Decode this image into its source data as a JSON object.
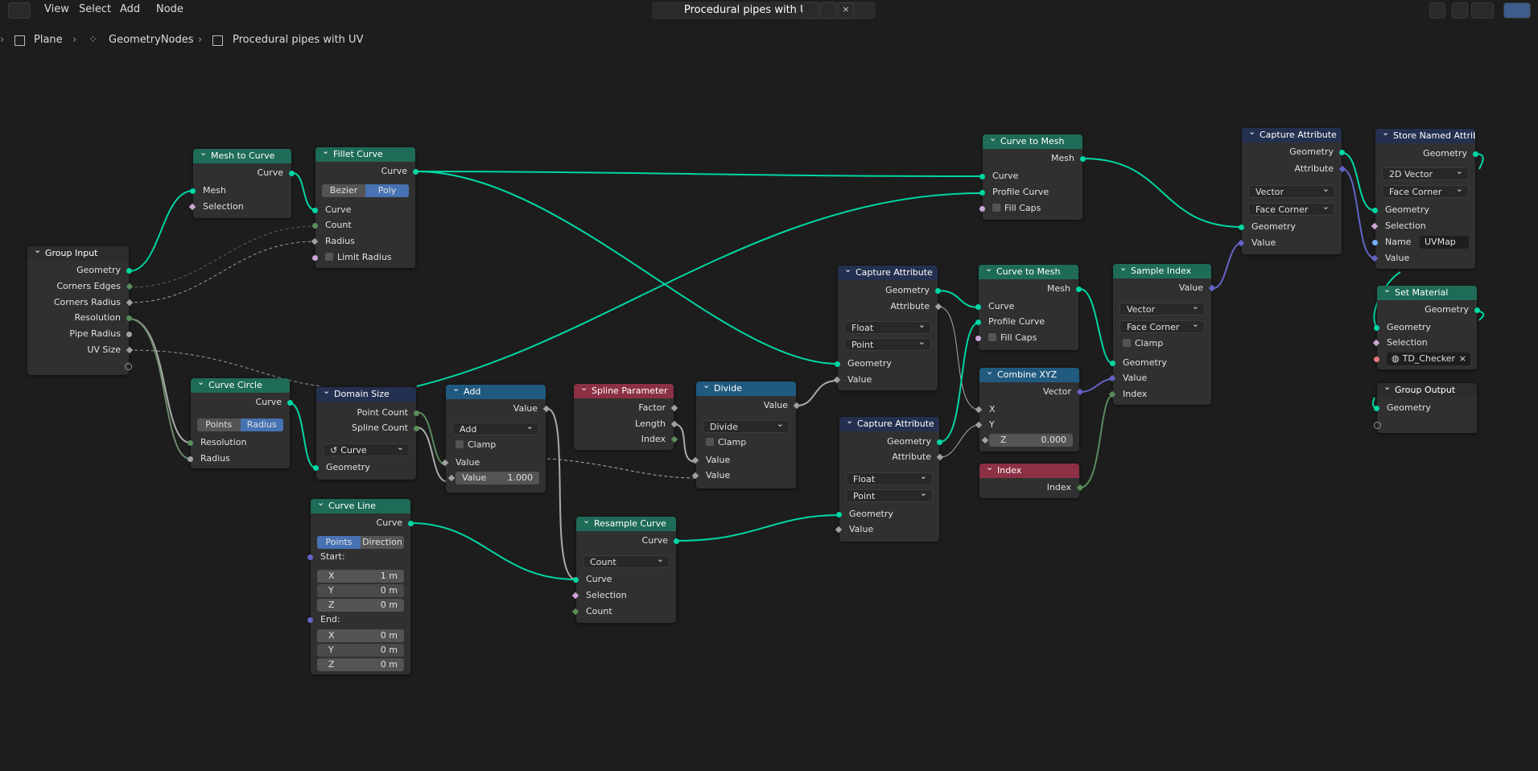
{
  "menubar": {
    "view": "View",
    "select": "Select",
    "add": "Add",
    "node": "Node"
  },
  "header": {
    "tree_name": "Procedural pipes with UV"
  },
  "breadcrumb": {
    "object": "Plane",
    "modifier": "GeometryNodes",
    "tree": "Procedural pipes with UV"
  },
  "colors": {
    "geometry_socket": "#00d6a3",
    "float_socket": "#a1a1a1",
    "vector_socket": "#6363c7",
    "boolean_socket": "#cca6d6",
    "integer_socket": "#598c5c",
    "string_socket": "#70b2ff",
    "material_socket": "#eb7582",
    "geometry_header": "#1e6b58",
    "attribute_header": "#24304f",
    "converter_header": "#215a7f",
    "input_header": "#8b3045",
    "selected_option": "#4772b3"
  },
  "icons": [
    "editor-type-icon",
    "node-tree-icon",
    "shield-icon",
    "duplicate-icon",
    "close-icon",
    "pin-icon",
    "parent-icon",
    "undo-icon",
    "snap-icon",
    "overlay-icon",
    "object-icon",
    "geometry-nodes-icon",
    "material-icon"
  ],
  "nodes": {
    "group_input": {
      "title": "Group Input",
      "geometry": "Geometry",
      "corners_edges": "Corners Edges",
      "corners_radius": "Corners Radius",
      "resolution": "Resolution",
      "pipe_radius": "Pipe Radius",
      "uv_size": "UV Size"
    },
    "mesh_to_curve": {
      "title": "Mesh to Curve",
      "curve": "Curve",
      "mesh": "Mesh",
      "selection": "Selection"
    },
    "fillet_curve": {
      "title": "Fillet Curve",
      "curve_out": "Curve",
      "mode_bezier": "Bezier",
      "mode_poly": "Poly",
      "curve_in": "Curve",
      "count": "Count",
      "radius": "Radius",
      "limit_radius": "Limit Radius"
    },
    "curve_circle": {
      "title": "Curve Circle",
      "curve": "Curve",
      "mode_points": "Points",
      "mode_radius": "Radius",
      "resolution": "Resolution",
      "radius": "Radius"
    },
    "domain_size": {
      "title": "Domain Size",
      "point_count": "Point Count",
      "spline_count": "Spline Count",
      "component": "Curve",
      "geometry": "Geometry"
    },
    "add": {
      "title": "Add",
      "value_out": "Value",
      "operation": "Add",
      "clamp": "Clamp",
      "value_in": "Value",
      "value_label": "Value",
      "value_field": "1.000"
    },
    "spline_parameter": {
      "title": "Spline Parameter",
      "factor": "Factor",
      "length": "Length",
      "index": "Index"
    },
    "divide": {
      "title": "Divide",
      "value_out": "Value",
      "operation": "Divide",
      "clamp": "Clamp",
      "value_a": "Value",
      "value_b": "Value"
    },
    "capture_attr_1": {
      "title": "Capture Attribute",
      "geometry_out": "Geometry",
      "attribute": "Attribute",
      "type": "Float",
      "domain": "Point",
      "geometry_in": "Geometry",
      "value": "Value"
    },
    "capture_attr_2": {
      "title": "Capture Attribute",
      "geometry_out": "Geometry",
      "attribute": "Attribute",
      "type": "Float",
      "domain": "Point",
      "geometry_in": "Geometry",
      "value": "Value"
    },
    "curve_line": {
      "title": "Curve Line",
      "curve": "Curve",
      "mode_points": "Points",
      "mode_direction": "Direction",
      "start": "Start:",
      "start_x_label": "X",
      "start_x": "1 m",
      "start_y_label": "Y",
      "start_y": "0 m",
      "start_z_label": "Z",
      "start_z": "0 m",
      "end": "End:",
      "end_x_label": "X",
      "end_x": "0 m",
      "end_y_label": "Y",
      "end_y": "0 m",
      "end_z_label": "Z",
      "end_z": "0 m"
    },
    "resample_curve": {
      "title": "Resample Curve",
      "curve_out": "Curve",
      "mode": "Count",
      "curve_in": "Curve",
      "selection": "Selection",
      "count": "Count"
    },
    "curve_to_mesh_1": {
      "title": "Curve to Mesh",
      "mesh": "Mesh",
      "curve": "Curve",
      "profile": "Profile Curve",
      "fill_caps": "Fill Caps"
    },
    "curve_to_mesh_2": {
      "title": "Curve to Mesh",
      "mesh": "Mesh",
      "curve": "Curve",
      "profile": "Profile Curve",
      "fill_caps": "Fill Caps"
    },
    "combine_xyz": {
      "title": "Combine XYZ",
      "vector": "Vector",
      "x": "X",
      "y": "Y",
      "z_label": "Z",
      "z_value": "0.000"
    },
    "index": {
      "title": "Index",
      "index": "Index"
    },
    "sample_index": {
      "title": "Sample Index",
      "value_out": "Value",
      "type": "Vector",
      "domain": "Face Corner",
      "clamp": "Clamp",
      "geometry": "Geometry",
      "value_in": "Value",
      "index": "Index"
    },
    "capture_attr_3": {
      "title": "Capture Attribute",
      "geometry_out": "Geometry",
      "attribute": "Attribute",
      "type": "Vector",
      "domain": "Face Corner",
      "geometry_in": "Geometry",
      "value": "Value"
    },
    "store_named": {
      "title": "Store Named Attrib...",
      "geometry_out": "Geometry",
      "type": "2D Vector",
      "domain": "Face Corner",
      "geometry_in": "Geometry",
      "selection": "Selection",
      "name_label": "Name",
      "name_value": "UVMap",
      "value": "Value"
    },
    "set_material": {
      "title": "Set Material",
      "geometry_out": "Geometry",
      "geometry_in": "Geometry",
      "selection": "Selection",
      "material": "TD_Checker"
    },
    "group_output": {
      "title": "Group Output",
      "geometry": "Geometry"
    }
  }
}
